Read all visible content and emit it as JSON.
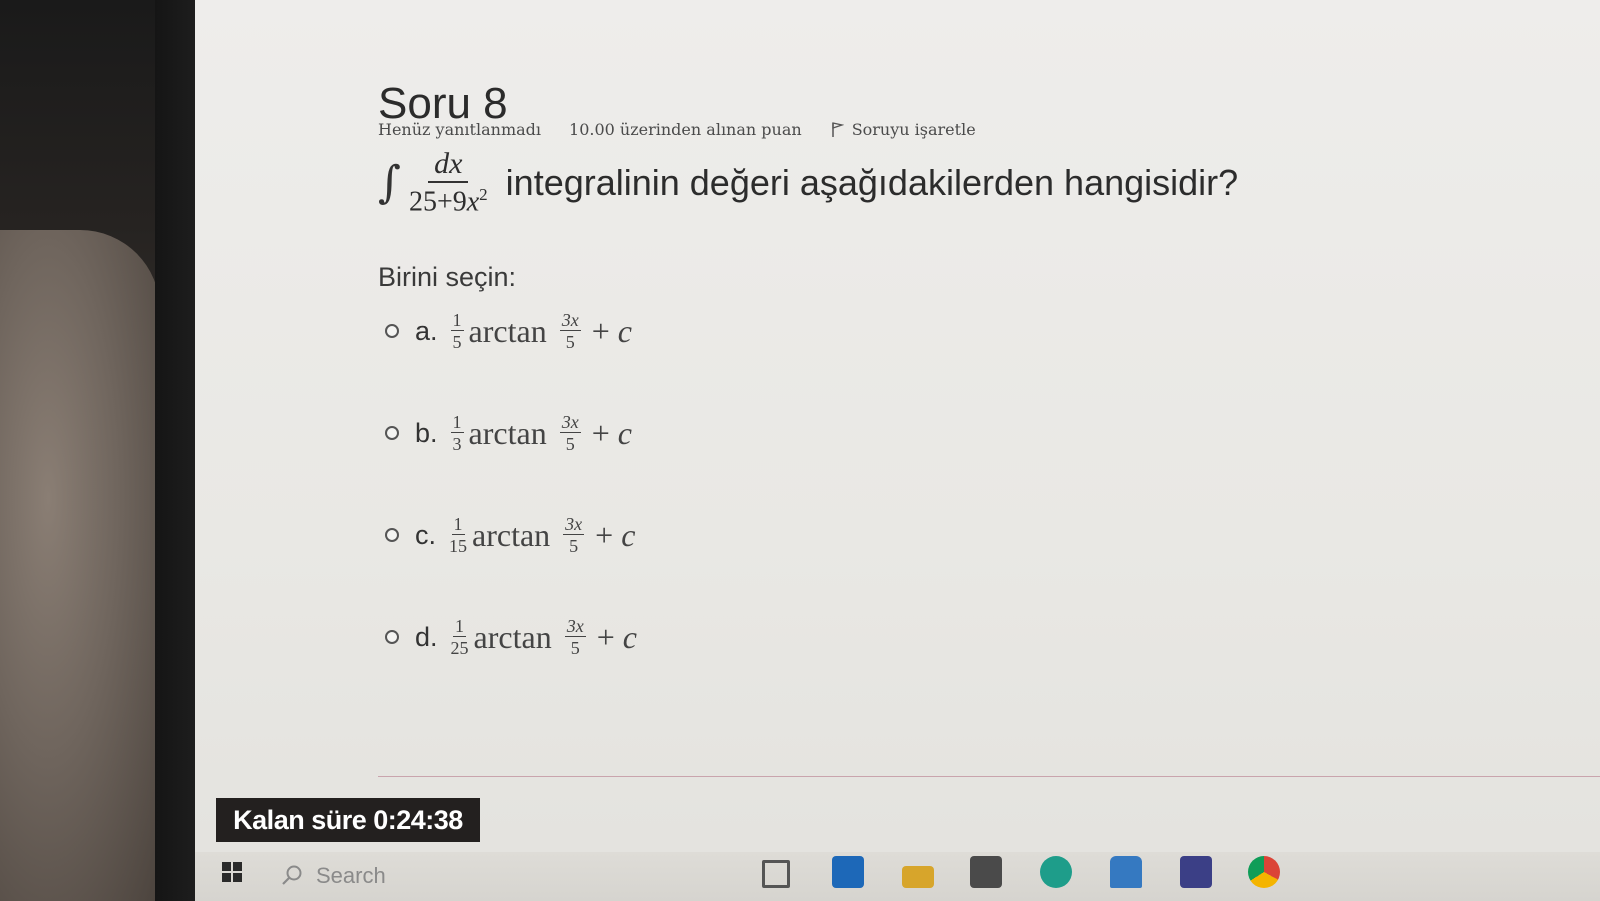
{
  "question": {
    "title": "Soru 8",
    "status": "Henüz yanıtlanmadı",
    "points": "10.00 üzerinden alınan puan",
    "flag_label": "Soruyu işaretle",
    "integral_sign": "∫",
    "numerator": "dx",
    "denominator_constant": "25+9",
    "denominator_var": "x",
    "denominator_exp": "2",
    "text": "integralinin değeri aşağıdakilerden hangisidir?",
    "choose_label": "Birini seçin:"
  },
  "options": [
    {
      "letter": "a.",
      "coef_num": "1",
      "coef_den": "5",
      "fn": "arctan",
      "arg_num": "3x",
      "arg_den": "5",
      "plus": "+",
      "const": "c"
    },
    {
      "letter": "b.",
      "coef_num": "1",
      "coef_den": "3",
      "fn": "arctan",
      "arg_num": "3x",
      "arg_den": "5",
      "plus": "+",
      "const": "c"
    },
    {
      "letter": "c.",
      "coef_num": "1",
      "coef_den": "15",
      "fn": "arctan",
      "arg_num": "3x",
      "arg_den": "5",
      "plus": "+",
      "const": "c"
    },
    {
      "letter": "d.",
      "coef_num": "1",
      "coef_den": "25",
      "fn": "arctan",
      "arg_num": "3x",
      "arg_den": "5",
      "plus": "+",
      "const": "c"
    }
  ],
  "timer": {
    "label": "Kalan süre",
    "value": "0:24:38"
  },
  "taskbar": {
    "search_placeholder": "Search",
    "icons": [
      "windows-start-icon",
      "search-icon",
      "task-view-icon",
      "outlook-icon",
      "file-explorer-icon",
      "store-icon",
      "edge-icon",
      "mail-icon",
      "app-icon",
      "chrome-icon"
    ]
  }
}
